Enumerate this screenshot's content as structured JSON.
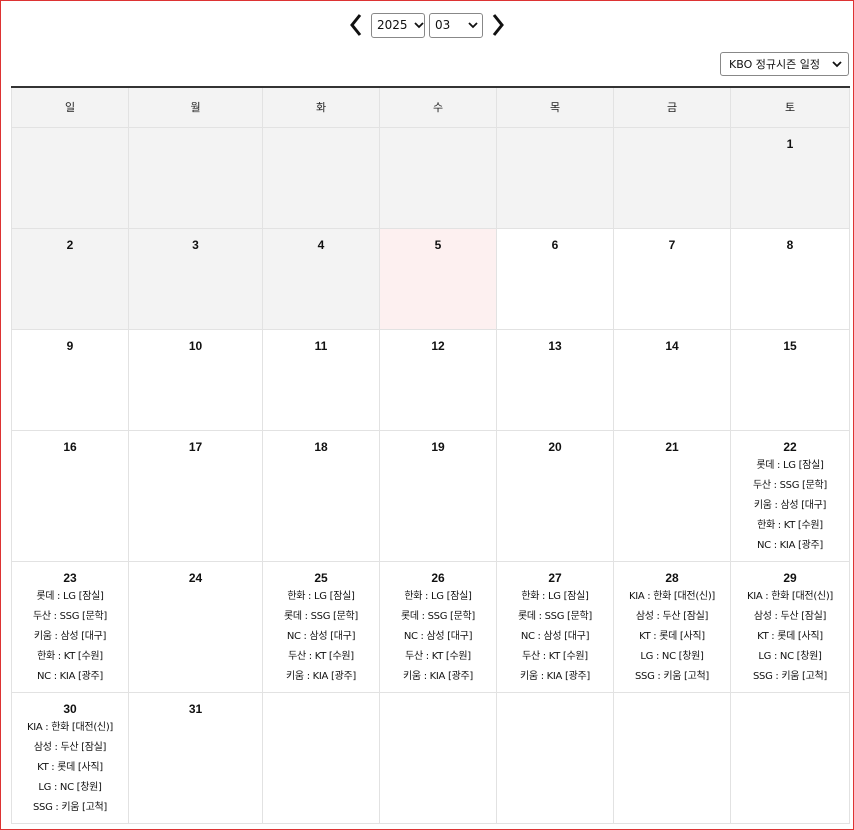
{
  "nav": {
    "year": "2025",
    "month": "03",
    "prev_icon": "chevron-left-icon",
    "next_icon": "chevron-right-icon"
  },
  "league_select": {
    "value": "KBO 정규시즌 일정"
  },
  "weekdays": [
    "일",
    "월",
    "화",
    "수",
    "목",
    "금",
    "토"
  ],
  "colors": {
    "past_bg": "#f3f3f3",
    "today_bg": "#fdf0f0",
    "header_bg": "#f3f3f3",
    "frame": "#dd3333"
  },
  "weeks": [
    {
      "days": [
        {
          "day": "",
          "state": "past",
          "games": []
        },
        {
          "day": "",
          "state": "past",
          "games": []
        },
        {
          "day": "",
          "state": "past",
          "games": []
        },
        {
          "day": "",
          "state": "past",
          "games": []
        },
        {
          "day": "",
          "state": "past",
          "games": []
        },
        {
          "day": "",
          "state": "past",
          "games": []
        },
        {
          "day": "1",
          "state": "past",
          "games": []
        }
      ]
    },
    {
      "days": [
        {
          "day": "2",
          "state": "past",
          "games": []
        },
        {
          "day": "3",
          "state": "past",
          "games": []
        },
        {
          "day": "4",
          "state": "past",
          "games": []
        },
        {
          "day": "5",
          "state": "today",
          "games": []
        },
        {
          "day": "6",
          "state": "",
          "games": []
        },
        {
          "day": "7",
          "state": "",
          "games": []
        },
        {
          "day": "8",
          "state": "",
          "games": []
        }
      ]
    },
    {
      "days": [
        {
          "day": "9",
          "state": "",
          "games": []
        },
        {
          "day": "10",
          "state": "",
          "games": []
        },
        {
          "day": "11",
          "state": "",
          "games": []
        },
        {
          "day": "12",
          "state": "",
          "games": []
        },
        {
          "day": "13",
          "state": "",
          "games": []
        },
        {
          "day": "14",
          "state": "",
          "games": []
        },
        {
          "day": "15",
          "state": "",
          "games": []
        }
      ]
    },
    {
      "days": [
        {
          "day": "16",
          "state": "",
          "games": []
        },
        {
          "day": "17",
          "state": "",
          "games": []
        },
        {
          "day": "18",
          "state": "",
          "games": []
        },
        {
          "day": "19",
          "state": "",
          "games": []
        },
        {
          "day": "20",
          "state": "",
          "games": []
        },
        {
          "day": "21",
          "state": "",
          "games": []
        },
        {
          "day": "22",
          "state": "",
          "games": [
            "롯데 : LG [잠실]",
            "두산 : SSG [문학]",
            "키움 : 삼성 [대구]",
            "한화 : KT [수원]",
            "NC : KIA [광주]"
          ]
        }
      ]
    },
    {
      "days": [
        {
          "day": "23",
          "state": "",
          "games": [
            "롯데 : LG [잠실]",
            "두산 : SSG [문학]",
            "키움 : 삼성 [대구]",
            "한화 : KT [수원]",
            "NC : KIA [광주]"
          ]
        },
        {
          "day": "24",
          "state": "",
          "games": []
        },
        {
          "day": "25",
          "state": "",
          "games": [
            "한화 : LG [잠실]",
            "롯데 : SSG [문학]",
            "NC : 삼성 [대구]",
            "두산 : KT [수원]",
            "키움 : KIA [광주]"
          ]
        },
        {
          "day": "26",
          "state": "",
          "games": [
            "한화 : LG [잠실]",
            "롯데 : SSG [문학]",
            "NC : 삼성 [대구]",
            "두산 : KT [수원]",
            "키움 : KIA [광주]"
          ]
        },
        {
          "day": "27",
          "state": "",
          "games": [
            "한화 : LG [잠실]",
            "롯데 : SSG [문학]",
            "NC : 삼성 [대구]",
            "두산 : KT [수원]",
            "키움 : KIA [광주]"
          ]
        },
        {
          "day": "28",
          "state": "",
          "games": [
            "KIA : 한화 [대전(신)]",
            "삼성 : 두산 [잠실]",
            "KT : 롯데 [사직]",
            "LG : NC [창원]",
            "SSG : 키움 [고척]"
          ]
        },
        {
          "day": "29",
          "state": "",
          "games": [
            "KIA : 한화 [대전(신)]",
            "삼성 : 두산 [잠실]",
            "KT : 롯데 [사직]",
            "LG : NC [창원]",
            "SSG : 키움 [고척]"
          ]
        }
      ]
    },
    {
      "days": [
        {
          "day": "30",
          "state": "",
          "games": [
            "KIA : 한화 [대전(신)]",
            "삼성 : 두산 [잠실]",
            "KT : 롯데 [사직]",
            "LG : NC [창원]",
            "SSG : 키움 [고척]"
          ]
        },
        {
          "day": "31",
          "state": "",
          "games": []
        },
        {
          "day": "",
          "state": "",
          "games": []
        },
        {
          "day": "",
          "state": "",
          "games": []
        },
        {
          "day": "",
          "state": "",
          "games": []
        },
        {
          "day": "",
          "state": "",
          "games": []
        },
        {
          "day": "",
          "state": "",
          "games": []
        }
      ]
    }
  ]
}
